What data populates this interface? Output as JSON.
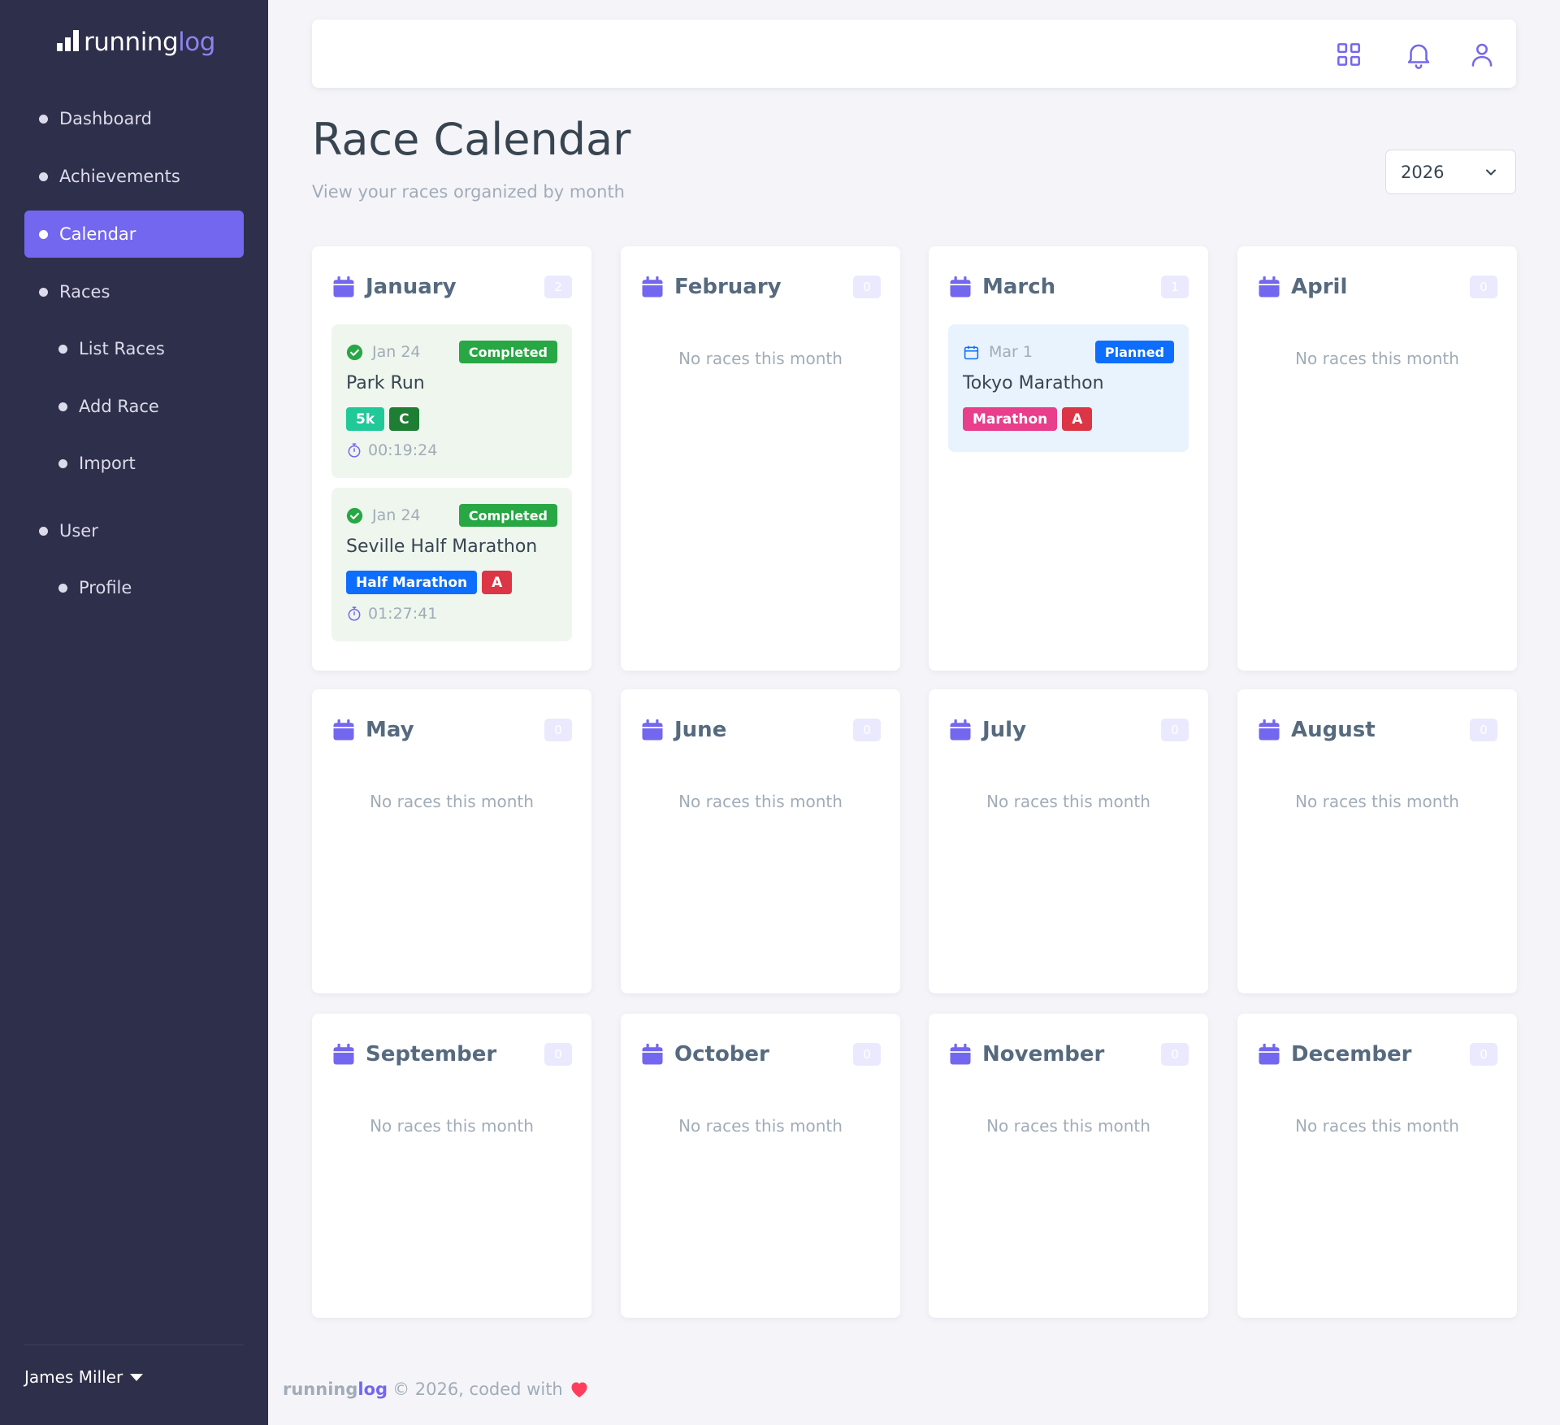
{
  "app": {
    "logo_text": "running",
    "logo_accent": "log",
    "accent_color": "#7367f0"
  },
  "sidebar": {
    "items": [
      {
        "label": "Dashboard"
      },
      {
        "label": "Achievements"
      },
      {
        "label": "Calendar"
      },
      {
        "label": "Races"
      },
      {
        "label": "List Races"
      },
      {
        "label": "Add Race"
      },
      {
        "label": "Import"
      },
      {
        "label": "User"
      },
      {
        "label": "Profile"
      }
    ],
    "active_item": "Calendar",
    "user_name": "James Miller"
  },
  "topbar": {
    "icons": [
      "grid-icon",
      "bell-icon",
      "user-icon"
    ]
  },
  "header": {
    "title": "Race Calendar",
    "subtitle": "View your races organized by month",
    "year_selected": "2026"
  },
  "months": [
    {
      "name": "January",
      "count": "2",
      "empty_text": "",
      "races": [
        {
          "date": "Jan 24",
          "status": "Completed",
          "name": "Park Run",
          "distance": "5k",
          "grade": "C",
          "time": "00:19:24"
        },
        {
          "date": "Jan 24",
          "status": "Completed",
          "name": "Seville Half Marathon",
          "distance": "Half Marathon",
          "grade": "A",
          "time": "01:27:41"
        }
      ]
    },
    {
      "name": "February",
      "count": "0",
      "empty_text": "No races this month"
    },
    {
      "name": "March",
      "count": "1",
      "empty_text": "",
      "races": [
        {
          "date": "Mar 1",
          "status": "Planned",
          "name": "Tokyo Marathon",
          "distance": "Marathon",
          "grade": "A"
        }
      ]
    },
    {
      "name": "April",
      "count": "0",
      "empty_text": "No races this month"
    },
    {
      "name": "May",
      "count": "0",
      "empty_text": "No races this month"
    },
    {
      "name": "June",
      "count": "0",
      "empty_text": "No races this month"
    },
    {
      "name": "July",
      "count": "0",
      "empty_text": "No races this month"
    },
    {
      "name": "August",
      "count": "0",
      "empty_text": "No races this month"
    },
    {
      "name": "September",
      "count": "0",
      "empty_text": "No races this month"
    },
    {
      "name": "October",
      "count": "0",
      "empty_text": "No races this month"
    },
    {
      "name": "November",
      "count": "0",
      "empty_text": "No races this month"
    },
    {
      "name": "December",
      "count": "0",
      "empty_text": "No races this month"
    }
  ],
  "footer": {
    "brand_text": "running",
    "brand_accent": "log",
    "copyright": "© 2026, coded with"
  }
}
